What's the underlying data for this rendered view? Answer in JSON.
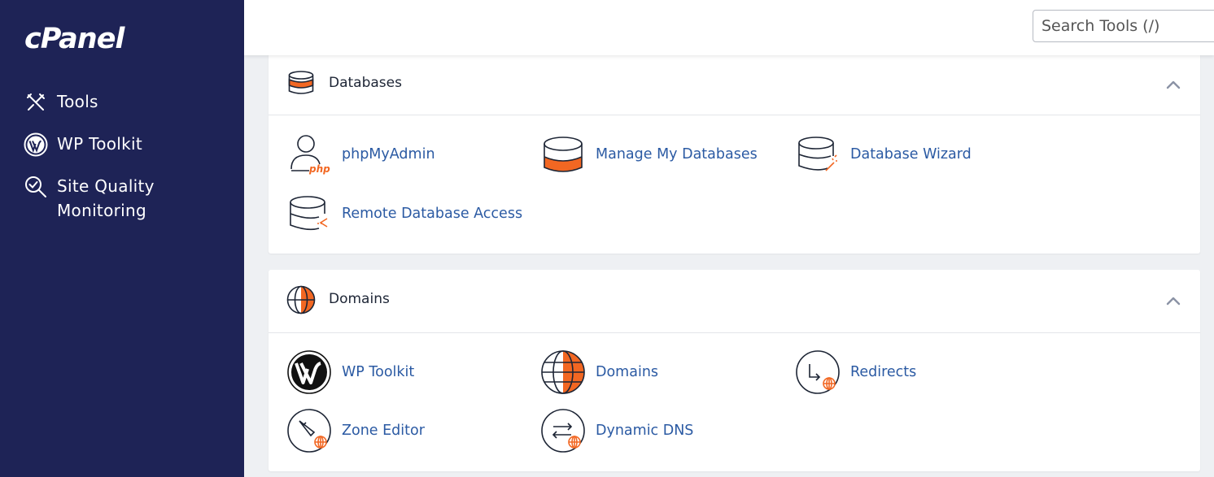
{
  "brand": {
    "logo_text": "cPanel"
  },
  "sidebar": {
    "items": [
      {
        "label": "Tools",
        "icon": "tools-icon"
      },
      {
        "label": "WP Toolkit",
        "icon": "wordpress-icon"
      },
      {
        "label": "Site Quality Monitoring",
        "icon": "site-quality-icon"
      }
    ]
  },
  "header": {
    "search_placeholder": "Search Tools (/)"
  },
  "sections": {
    "databases": {
      "title": "Databases",
      "items": [
        {
          "label": "phpMyAdmin",
          "icon": "phpmyadmin-icon"
        },
        {
          "label": "Manage My Databases",
          "icon": "database-icon"
        },
        {
          "label": "Database Wizard",
          "icon": "database-wizard-icon"
        },
        {
          "label": "Remote Database Access",
          "icon": "remote-database-icon"
        }
      ]
    },
    "domains": {
      "title": "Domains",
      "items": [
        {
          "label": "WP Toolkit",
          "icon": "wordpress-icon"
        },
        {
          "label": "Domains",
          "icon": "globe-icon"
        },
        {
          "label": "Redirects",
          "icon": "redirect-icon"
        },
        {
          "label": "Zone Editor",
          "icon": "zone-editor-icon"
        },
        {
          "label": "Dynamic DNS",
          "icon": "dynamic-dns-icon"
        }
      ]
    }
  },
  "colors": {
    "sidebar_bg": "#1e2356",
    "accent": "#f26722",
    "link": "#2b5aa3"
  }
}
